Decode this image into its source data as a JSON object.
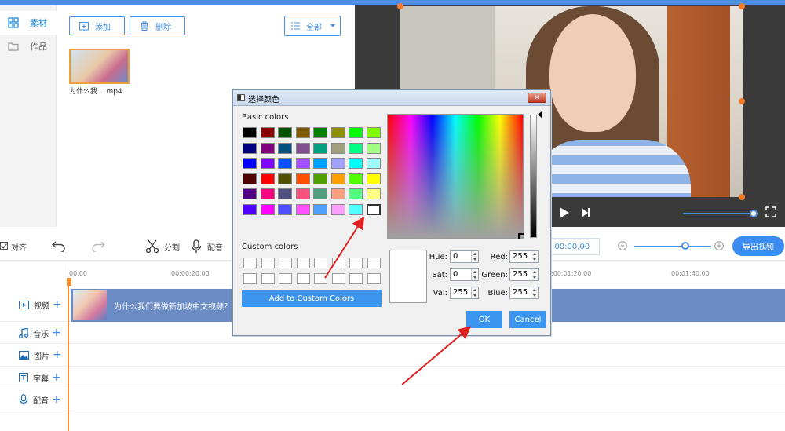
{
  "sidebar": {
    "items": [
      {
        "label": "素材",
        "icon": "grid-icon"
      },
      {
        "label": "作品",
        "icon": "folder-icon"
      }
    ]
  },
  "library": {
    "add_label": "添加",
    "delete_label": "删除",
    "filter_label": "全部",
    "files": [
      {
        "name": "为什么我....mp4"
      }
    ]
  },
  "toolbar": {
    "align_label": "对齐",
    "split_label": "分割",
    "dub_label": "配音",
    "timecode": ":00:00,00",
    "export_label": "导出视频"
  },
  "timeline": {
    "ticks": [
      "00,00",
      "00:00:20,00",
      ":00:01:20,00",
      "00:01:40,00"
    ],
    "tracks": [
      {
        "label": "视频",
        "icon": "video-icon"
      },
      {
        "label": "音乐",
        "icon": "music-icon"
      },
      {
        "label": "图片",
        "icon": "image-icon"
      },
      {
        "label": "字幕",
        "icon": "text-icon"
      },
      {
        "label": "配音",
        "icon": "mic-icon"
      }
    ],
    "clip_title": "为什么我们要做新加坡中文视频？新"
  },
  "dialog": {
    "title": "选择颜色",
    "close_label": "✕",
    "basic_colors_label": "Basic colors",
    "custom_colors_label": "Custom colors",
    "add_custom_label": "Add to Custom Colors",
    "basic_colors": [
      [
        "#000000",
        "#8b0000",
        "#005000",
        "#7f5a00",
        "#008000",
        "#8f8f00",
        "#00ff00",
        "#80ff00"
      ],
      [
        "#000080",
        "#800080",
        "#005080",
        "#80508f",
        "#00a080",
        "#a0a080",
        "#00ff80",
        "#a0ff80"
      ],
      [
        "#0000ff",
        "#8000ff",
        "#0050ff",
        "#a050ff",
        "#00a0ff",
        "#a0a0ff",
        "#00ffff",
        "#a0ffff"
      ],
      [
        "#500000",
        "#ff0000",
        "#505000",
        "#ff5000",
        "#50a000",
        "#ffa000",
        "#50ff00",
        "#ffff00"
      ],
      [
        "#500080",
        "#ff0080",
        "#505080",
        "#ff5080",
        "#50a080",
        "#ffa080",
        "#50ff80",
        "#ffff80"
      ],
      [
        "#5000ff",
        "#ff00ff",
        "#5050ff",
        "#ff50ff",
        "#50a0ff",
        "#ffa0ff",
        "#50ffff",
        "#ffffff"
      ]
    ],
    "selected_color": "#ffffff",
    "hue_label": "Hue:",
    "hue": "0",
    "sat_label": "Sat:",
    "sat": "0",
    "val_label": "Val:",
    "val": "255",
    "red_label": "Red:",
    "red": "255",
    "green_label": "Green:",
    "green": "255",
    "blue_label": "Blue:",
    "blue": "255",
    "ok_label": "OK",
    "cancel_label": "Cancel"
  },
  "colors": {
    "accent": "#3b8cf0",
    "playhead": "#f28a2e",
    "arrow": "#e02020"
  }
}
